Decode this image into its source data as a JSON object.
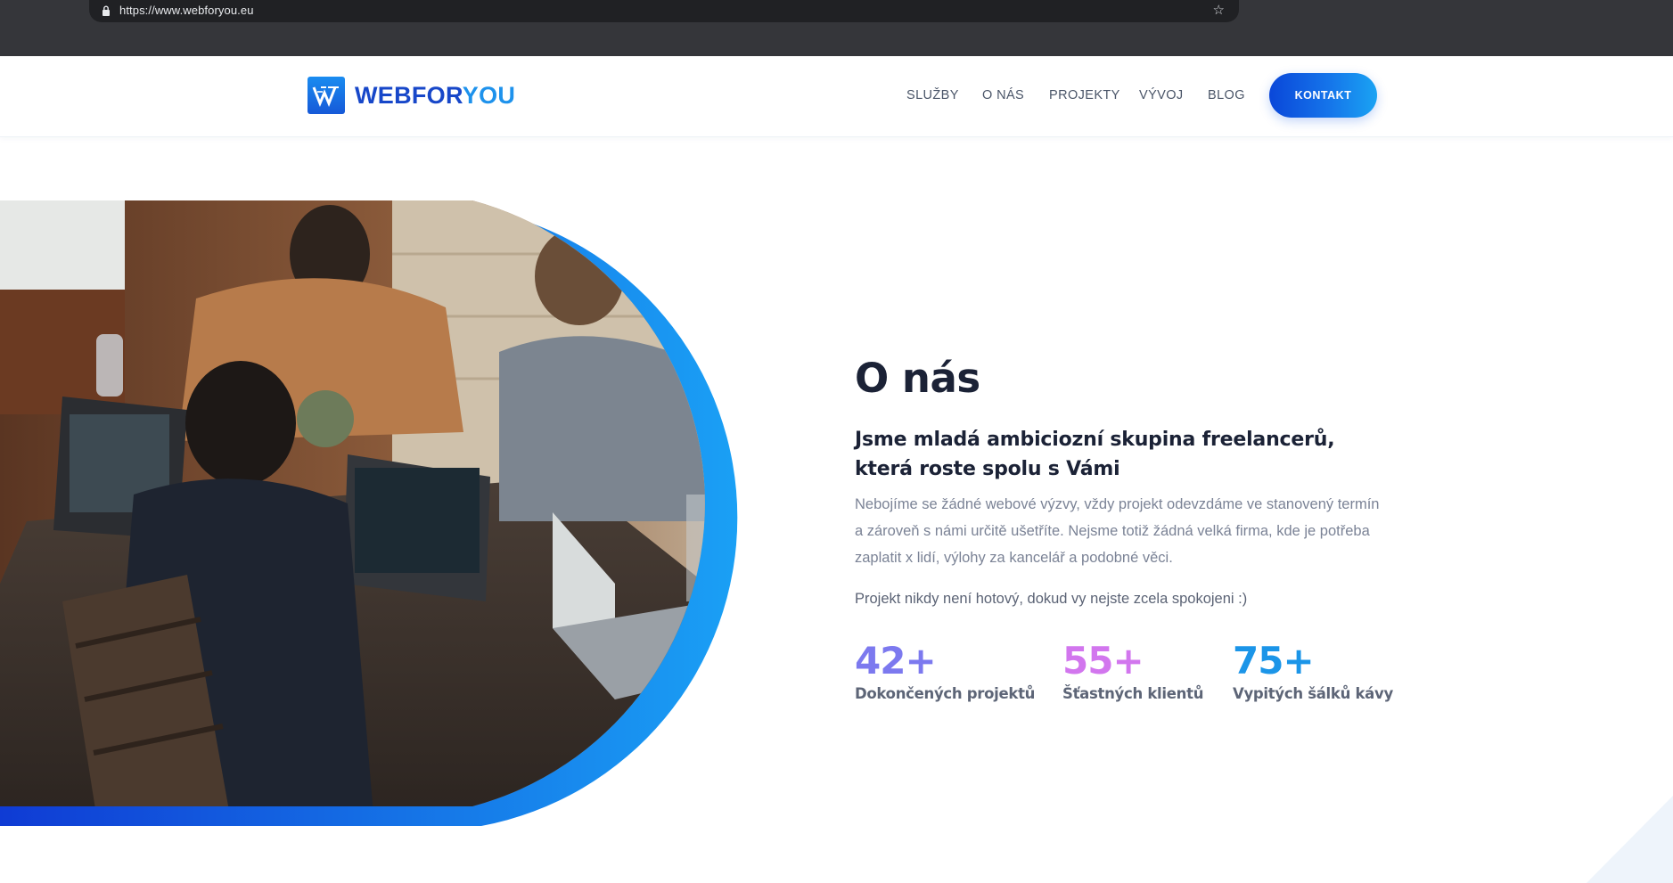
{
  "browser": {
    "url": "https://www.webforyou.eu",
    "lock_icon": "lock-icon",
    "bookmark_icon": "star-icon"
  },
  "header": {
    "logo": {
      "part1": "WEBFOR",
      "part2": "YOU",
      "icon": "logo-w-icon"
    },
    "nav": [
      {
        "label": "SLUŽBY"
      },
      {
        "label": "O NÁS"
      },
      {
        "label": "PROJEKTY"
      },
      {
        "label": "VÝVOJ"
      },
      {
        "label": "BLOG"
      }
    ],
    "cta_label": "KONTAKT"
  },
  "about": {
    "title": "O nás",
    "subtitle": "Jsme mladá ambiciozní skupina freelancerů, která roste spolu s Vámi",
    "paragraph1": "Nebojíme se žádné webové výzvy, vždy projekt odevzdáme ve stanovený termín a zároveň s námi určitě ušetříte. Nejsme totiž žádná velká firma, kde je potřeba zaplatit x lidí, výlohy za kancelář a podobné věci.",
    "paragraph2": "Projekt nikdy není hotový, dokud vy nejste zcela spokojeni :)",
    "photo": "team-working-on-laptops-photo"
  },
  "stats": [
    {
      "value": "42+",
      "label": "Dokončených projektů",
      "color": "#7c79ef"
    },
    {
      "value": "55+",
      "label": "Šťastných klientů",
      "color": "#d276ee"
    },
    {
      "value": "75+",
      "label": "Vypitých šálků kávy",
      "color": "#1b95e8"
    }
  ],
  "colors": {
    "brand_blue": "#1747c9",
    "brand_light": "#1e92ec",
    "heading": "#1b2236",
    "text": "#7b8396"
  }
}
